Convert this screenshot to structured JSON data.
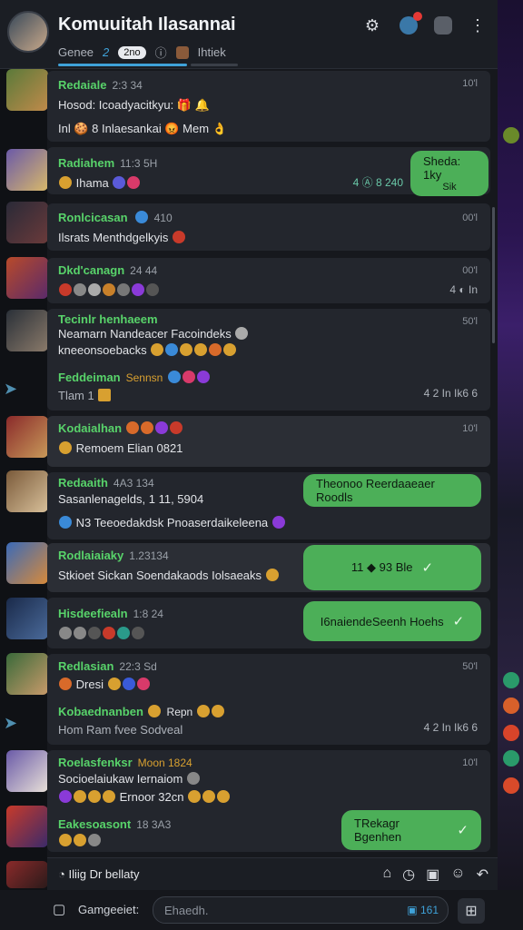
{
  "header": {
    "title": "Komuuitah Ilasannai",
    "tabs": [
      "Genee",
      "2",
      "2no",
      "Ihtiek"
    ],
    "icons": [
      "gear-icon",
      "notification-icon",
      "lock-icon",
      "more-icon"
    ]
  },
  "messages": [
    {
      "name": "Redaiale",
      "stamp": "2:3 34",
      "time": "10'l",
      "lines": [
        "Hosod: Icoadyacitkyu: 🎁 🔔",
        "Inl 🍪 8 Inlaesankai 😡 Mem 👌"
      ]
    },
    {
      "name": "Radiahem",
      "stamp": "11:3 5H",
      "time": "",
      "lines": [
        "Ihama",
        ""
      ],
      "meta": "4 Ⓐ 8 240"
    },
    {
      "name": "Ronlcicasan",
      "stamp": "410",
      "time": "00'l",
      "lines": [
        "Ilsrats Menthdgelkyis",
        ""
      ]
    },
    {
      "name": "Dkd'canagn",
      "stamp": "24 44",
      "time": "00'l",
      "lines": [
        ""
      ],
      "meta": "4 ◐ In"
    },
    {
      "name": "Tecinlr henhaeem",
      "stamp": "",
      "time": "50'l",
      "lines": [
        "Neamarn Nandeacer Facoindeks",
        "kneeonsoebacks"
      ]
    },
    {
      "name": "Feddeiman",
      "stamp": "Sennsn",
      "time": "",
      "lines": [
        "Tlam 1"
      ],
      "meta": "4 2 In Ik6 6"
    },
    {
      "name": "Kodaialhan",
      "stamp": "",
      "time": "10'l",
      "lines": [
        "Remoem Elian 0821"
      ]
    },
    {
      "name": "Redaaith",
      "stamp": "4A3 134",
      "time": "",
      "lines": [
        "Sasanlenagelds, 1 11, 5904",
        "N3 Teeoedakdsk Pnoaserdaikeleena"
      ]
    },
    {
      "name": "Rodlaiaiaky",
      "stamp": "1.23134",
      "time": "",
      "lines": [
        "Stkioet Sickan Soendakaods Iolsaeaks"
      ]
    },
    {
      "name": "Hisdeefiealn",
      "stamp": "1:8 24",
      "time": "",
      "lines": [
        ""
      ]
    },
    {
      "name": "Redlasian",
      "stamp": "22:3 Sd",
      "time": "50'l",
      "lines": [
        "Dresi",
        ""
      ]
    },
    {
      "name": "Kobaednanben",
      "stamp": "Repn",
      "time": "",
      "lines": [
        "Hom Ram fvee Sodveal"
      ],
      "meta": "4 2 In Ik6 6"
    },
    {
      "name": "Roelasfenksr",
      "stamp": "Moon 1824",
      "time": "10'l",
      "lines": [
        "Socioelaiukaw Iernaiom",
        "Ernoor 32cn"
      ]
    },
    {
      "name": "Eakesoasont",
      "stamp": "18 3A3",
      "time": "",
      "lines": [
        ""
      ]
    }
  ],
  "bubbles": [
    {
      "text": "Sheda: 1ky",
      "sub": "Sik"
    },
    {
      "text": "Theonoo Reerdaaeaer Roodls"
    },
    {
      "text": "11 ◆ 93 Ble"
    },
    {
      "text": "I6naiendeSeenh Hoehs"
    },
    {
      "text": "TRekagr Bgenhen"
    }
  ],
  "footer": {
    "typing": "Iliig Dr bellaty",
    "composer_label": "Gamgeeiet:",
    "input_placeholder": "Ehaedh.",
    "input_count": "161"
  },
  "colors": {
    "accent": "#3fa2d9",
    "name_green": "#58d36a",
    "bubble_green": "#4caf58",
    "badge_red": "#e53935"
  }
}
